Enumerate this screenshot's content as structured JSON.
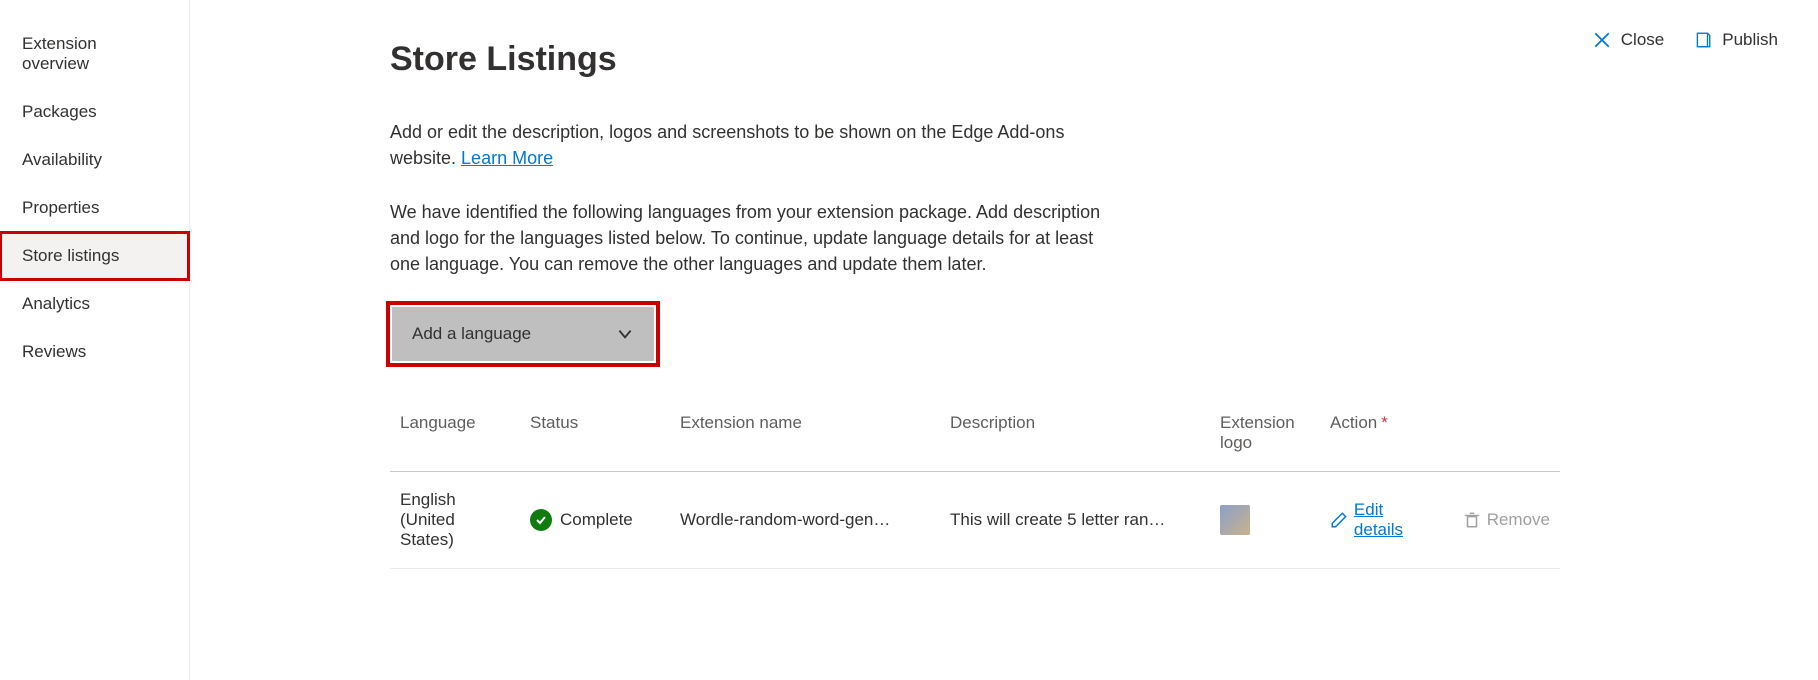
{
  "sidebar": {
    "items": [
      {
        "label": "Extension overview"
      },
      {
        "label": "Packages"
      },
      {
        "label": "Availability"
      },
      {
        "label": "Properties"
      },
      {
        "label": "Store listings"
      },
      {
        "label": "Analytics"
      },
      {
        "label": "Reviews"
      }
    ]
  },
  "header": {
    "close": "Close",
    "publish": "Publish"
  },
  "page": {
    "title": "Store Listings",
    "intro_prefix": "Add or edit the description, logos and screenshots to be shown on the Edge Add-ons website. ",
    "learn_more": "Learn More",
    "detected": "We have identified the following languages from your extension package. Add description and logo for the languages listed below. To continue, update language details for at least one language. You can remove the other languages and update them later.",
    "add_language": "Add a language"
  },
  "table": {
    "headers": {
      "language": "Language",
      "status": "Status",
      "ext_name": "Extension name",
      "description": "Description",
      "ext_logo": "Extension logo",
      "action": "Action"
    },
    "rows": [
      {
        "language": "English (United States)",
        "status": "Complete",
        "ext_name": "Wordle-random-word-gen…",
        "description": "This will create 5 letter ran…",
        "edit": "Edit details",
        "remove": "Remove"
      }
    ]
  }
}
